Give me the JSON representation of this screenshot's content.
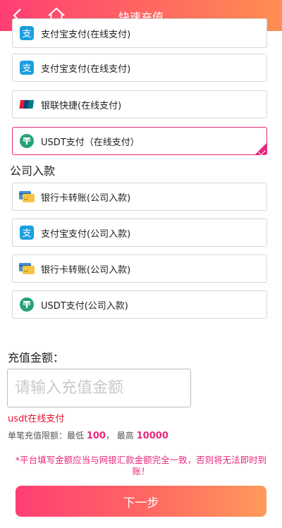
{
  "header": {
    "title": "快速充值"
  },
  "online_options": [
    {
      "label": "支付宝支付(在线支付)",
      "icon": "alipay-icon"
    },
    {
      "label": "支付宝支付(在线支付)",
      "icon": "alipay-icon"
    },
    {
      "label": "银联快捷(在线支付)",
      "icon": "unionpay-icon"
    },
    {
      "label": "USDT支付（在线支付）",
      "icon": "usdt-icon",
      "selected": true
    }
  ],
  "company_section": {
    "title": "公司入款",
    "options": [
      {
        "label": "银行卡转账(公司入款)",
        "icon": "bank-card-icon"
      },
      {
        "label": "支付宝支付(公司入款)",
        "icon": "alipay-icon"
      },
      {
        "label": "银行卡转账(公司入款)",
        "icon": "bank-card-icon"
      },
      {
        "label": "USDT支付(公司入款)",
        "icon": "usdt-icon"
      }
    ]
  },
  "amount": {
    "label": "充值金额：",
    "placeholder": "请输入充值金额",
    "value": ""
  },
  "selected_method": "usdt在线支付",
  "limit": {
    "prefix": "单笔充值限额：最低",
    "min": "100",
    "separator": "， 最高",
    "max": "10000"
  },
  "notice": "*平台填写金额应当与网银汇款金额完全一致，否则将无法即时到账！",
  "next_button": {
    "label": "下一步"
  },
  "colors": {
    "accent": "#e8287c",
    "header_start": "#ff3e74",
    "header_end": "#ff8f52",
    "alipay": "#1a9fe0",
    "usdt": "#26a17b"
  }
}
